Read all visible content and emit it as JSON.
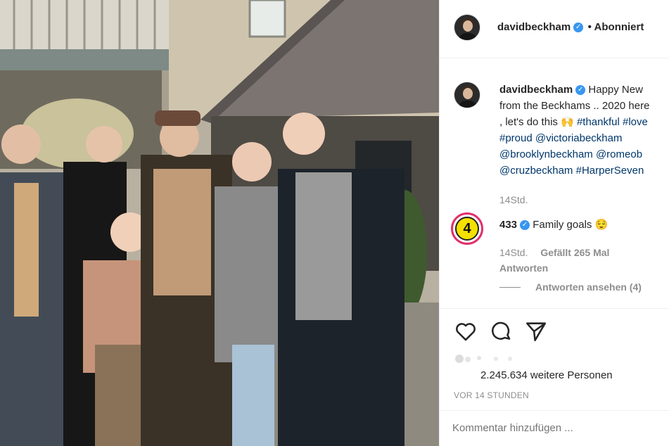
{
  "header": {
    "username": "davidbeckham",
    "follow_status": "• Abonniert"
  },
  "caption": {
    "username": "davidbeckham",
    "line1_text": "Happy New",
    "line2_text": "from the Beckhams .. 2020 here",
    "line3_text": ", let's do this",
    "line3_tags": "#thankful #love",
    "line4_tags": "#proud @victoriabeckham",
    "line5_tags": "@brooklynbeckham @romeob",
    "line6_tags": "@cruzbeckham #HarperSeven",
    "time": "14Std."
  },
  "comment": {
    "badge_number": "4",
    "username": "433",
    "text": "Family goals",
    "emoji": "😌",
    "time": "14Std.",
    "likes": "Gefällt 265 Mal",
    "reply": "Antworten",
    "view_replies": "Antworten ansehen (4)"
  },
  "actions": {
    "like": "heart-icon",
    "comment": "comment-icon",
    "share": "share-icon"
  },
  "likes": {
    "text": "2.245.634 weitere Personen"
  },
  "timestamp": "VOR 14 STUNDEN",
  "add_comment": {
    "placeholder": "Kommentar hinzufügen ..."
  },
  "colors": {
    "badge_ring": "#e1306c",
    "badge_fill": "#f5e100",
    "link": "#00376b",
    "verified": "#3897f0"
  }
}
